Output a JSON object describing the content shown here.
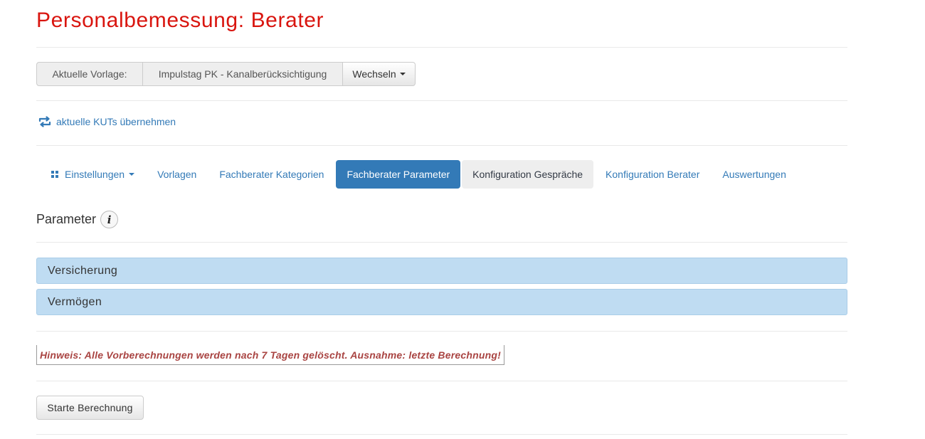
{
  "page": {
    "title": "Personalbemessung: Berater"
  },
  "template_selector": {
    "label": "Aktuelle Vorlage:",
    "value": "Impulstag PK - Kanalberücksichtigung",
    "switch_label": "Wechseln"
  },
  "kut_link": {
    "label": "aktuelle KUTs übernehmen",
    "icon": "retweet-icon"
  },
  "nav": {
    "items": [
      {
        "label": "Einstellungen",
        "icon": "th-large-icon",
        "dropdown": true
      },
      {
        "label": "Vorlagen"
      },
      {
        "label": "Fachberater Kategorien"
      },
      {
        "label": "Fachberater Parameter",
        "state": "active"
      },
      {
        "label": "Konfiguration Gespräche",
        "state": "hover"
      },
      {
        "label": "Konfiguration Berater"
      },
      {
        "label": "Auswertungen"
      }
    ]
  },
  "parameters": {
    "heading": "Parameter",
    "info_icon": "info-icon",
    "panels": [
      {
        "label": "Versicherung"
      },
      {
        "label": "Vermögen"
      }
    ]
  },
  "hint": {
    "text": "Hinweis: Alle Vorberechnungen werden nach 7 Tagen gelöscht. Ausnahme: letzte Berechnung!"
  },
  "actions": {
    "start_label": "Starte Berechnung"
  },
  "colors": {
    "title_red": "#d9150f",
    "link_blue": "#337ab7",
    "panel_blue": "#bfdcf2",
    "hint_red": "#a94442"
  }
}
